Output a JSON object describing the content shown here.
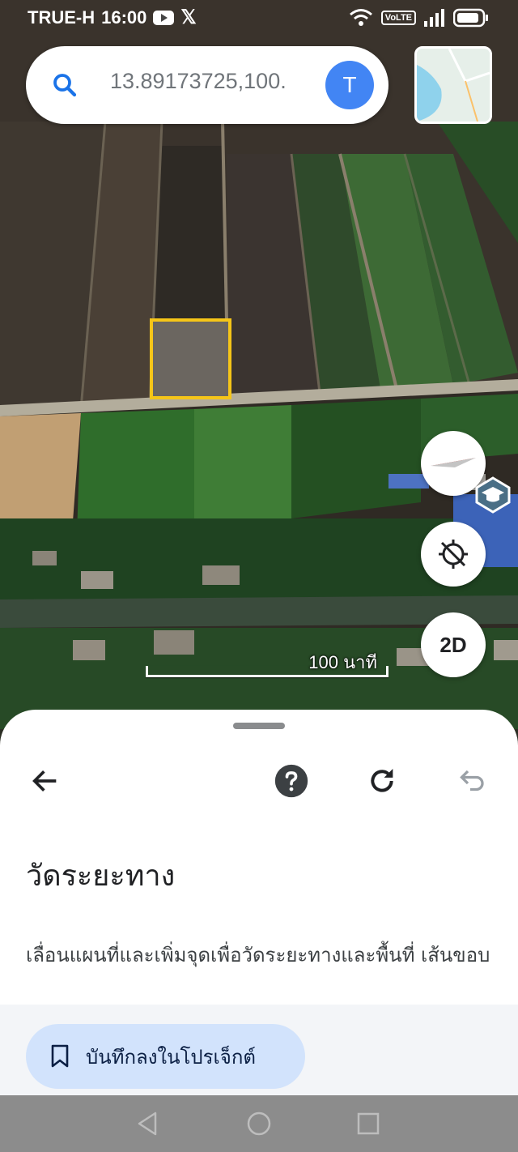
{
  "status_bar": {
    "carrier": "TRUE-H",
    "time": "16:00",
    "volte": "VoLTE"
  },
  "search": {
    "query": "13.89173725,100.",
    "avatar_letter": "T"
  },
  "map": {
    "scale_label": "100 นาที",
    "mode_button": "2D",
    "highlight_color": "#f5c518"
  },
  "sheet": {
    "title": "วัดระยะทาง",
    "description": "เลื่อนแผนที่และเพิ่มจุดเพื่อวัดระยะทางและพื้นที่ เส้นขอบ",
    "save_label": "บันทึกลงในโปรเจ็กต์"
  },
  "icons": {
    "search": "search-icon",
    "back": "arrow-left-icon",
    "help": "help-icon",
    "reset": "refresh-icon",
    "undo": "undo-icon",
    "bookmark": "bookmark-icon",
    "location": "location-off-icon",
    "compass": "compass-icon"
  }
}
